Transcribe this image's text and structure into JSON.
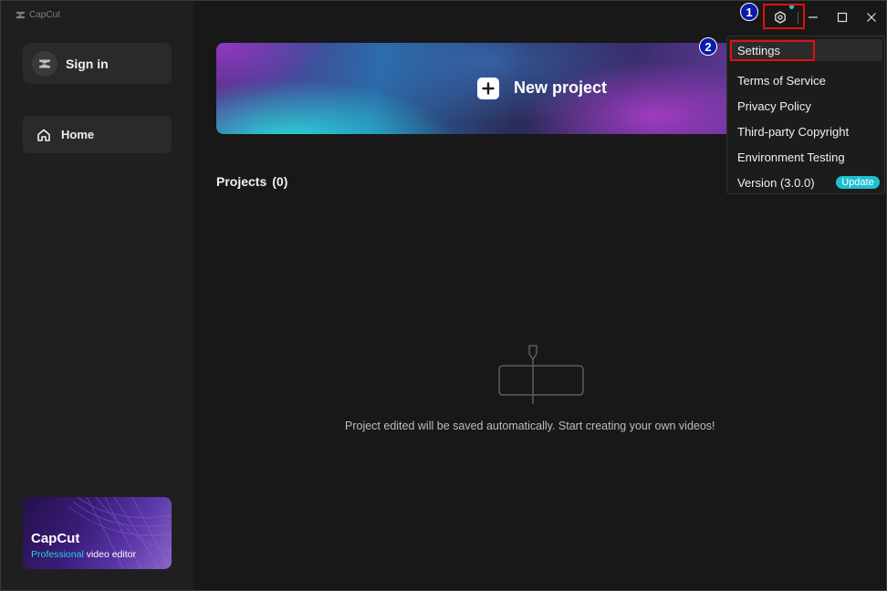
{
  "app": {
    "brand": "CapCut"
  },
  "sidebar": {
    "signin_label": "Sign in",
    "home_label": "Home",
    "promo": {
      "title": "CapCut",
      "subtitle_accent": "Professional",
      "subtitle_rest": " video editor"
    }
  },
  "main": {
    "new_project_label": "New project",
    "projects_title": "Projects",
    "projects_count": "(0)",
    "empty_message": "Project edited will be saved automatically. Start creating your own videos!"
  },
  "menu": {
    "items": [
      {
        "label": "Settings"
      },
      {
        "label": "Terms of Service"
      },
      {
        "label": "Privacy Policy"
      },
      {
        "label": "Third-party Copyright"
      },
      {
        "label": "Environment Testing"
      },
      {
        "label": "Version (3.0.0)"
      }
    ],
    "update_badge": "Update"
  },
  "annotations": {
    "n1": "1",
    "n2": "2"
  },
  "colors": {
    "accent": "#1fbfd0",
    "annotation": "#e01010",
    "background": "#181818",
    "sidebar": "#1f1f1f"
  },
  "icons": {
    "brand": "capcut-logo-icon",
    "settings": "gear-icon",
    "minimize": "minimize-icon",
    "maximize": "maximize-icon",
    "close": "close-icon",
    "home": "home-icon",
    "avatar": "capcut-logo-icon"
  }
}
